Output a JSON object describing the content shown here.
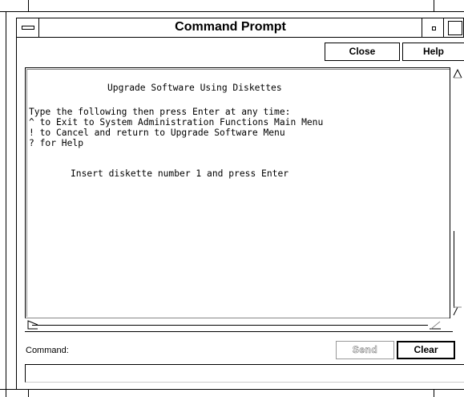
{
  "window": {
    "title": "Command Prompt"
  },
  "toolbar": {
    "close_label": "Close",
    "help_label": "Help"
  },
  "output": {
    "heading": "Upgrade Software Using Diskettes",
    "lines": [
      "Type the following then press Enter at any time:",
      "^ to Exit to System Administration Functions Main Menu",
      "! to Cancel and return to Upgrade Software Menu",
      "? for Help"
    ],
    "instruction": "Insert diskette number 1 and press Enter"
  },
  "command": {
    "label": "Command:",
    "send_label": "Send",
    "clear_label": "Clear",
    "input_value": ""
  },
  "icons": {
    "window_menu": "window-menu-icon",
    "minimize": "minimize-icon",
    "maximize": "maximize-icon",
    "scroll_up": "scroll-up-arrow-icon",
    "scroll_down": "scroll-down-arrow-icon",
    "scroll_left": "scroll-left-arrow-icon",
    "scroll_right": "scroll-right-arrow-icon"
  }
}
